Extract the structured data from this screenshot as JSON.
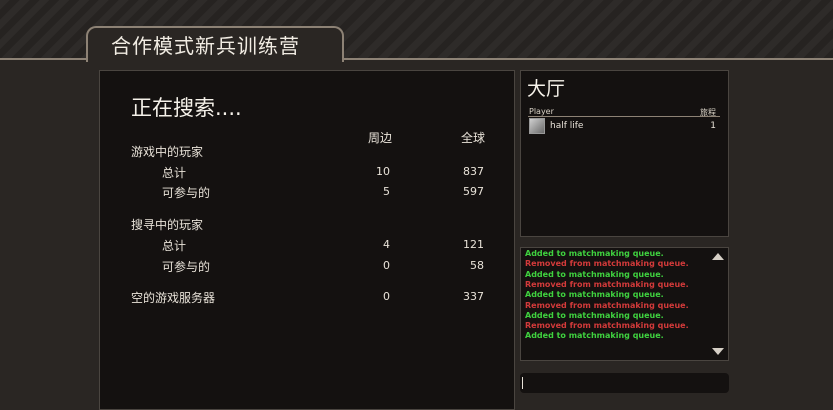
{
  "header": {
    "title": "合作模式新兵训练营"
  },
  "search": {
    "status": "正在搜索....",
    "col_nearby": "周边",
    "col_global": "全球",
    "players_in_game": "游戏中的玩家",
    "total_1": "总计",
    "joinable_1": "可参与的",
    "in_game_total_nearby": "10",
    "in_game_total_global": "837",
    "in_game_joinable_nearby": "5",
    "in_game_joinable_global": "597",
    "players_searching": "搜寻中的玩家",
    "total_2": "总计",
    "joinable_2": "可参与的",
    "searching_total_nearby": "4",
    "searching_total_global": "121",
    "searching_joinable_nearby": "0",
    "searching_joinable_global": "58",
    "empty_servers": "空的游戏服务器",
    "empty_nearby": "0",
    "empty_global": "337"
  },
  "lobby": {
    "title": "大厅",
    "col_player": "Player",
    "col_level": "旅程",
    "players": [
      {
        "name": "half life",
        "level": "1"
      }
    ]
  },
  "log": {
    "green": "#3fd13f",
    "red": "#d23a3a",
    "lines": [
      {
        "text": "Added to matchmaking queue.",
        "type": "added"
      },
      {
        "text": "Removed from matchmaking queue.",
        "type": "removed"
      },
      {
        "text": "Added to matchmaking queue.",
        "type": "added"
      },
      {
        "text": "Removed from matchmaking queue.",
        "type": "removed"
      },
      {
        "text": "Added to matchmaking queue.",
        "type": "added"
      },
      {
        "text": "Removed from matchmaking queue.",
        "type": "removed"
      },
      {
        "text": "Added to matchmaking queue.",
        "type": "added"
      },
      {
        "text": "Removed from matchmaking queue.",
        "type": "removed"
      },
      {
        "text": "Added to matchmaking queue.",
        "type": "added"
      }
    ]
  },
  "chat": {
    "value": ""
  }
}
